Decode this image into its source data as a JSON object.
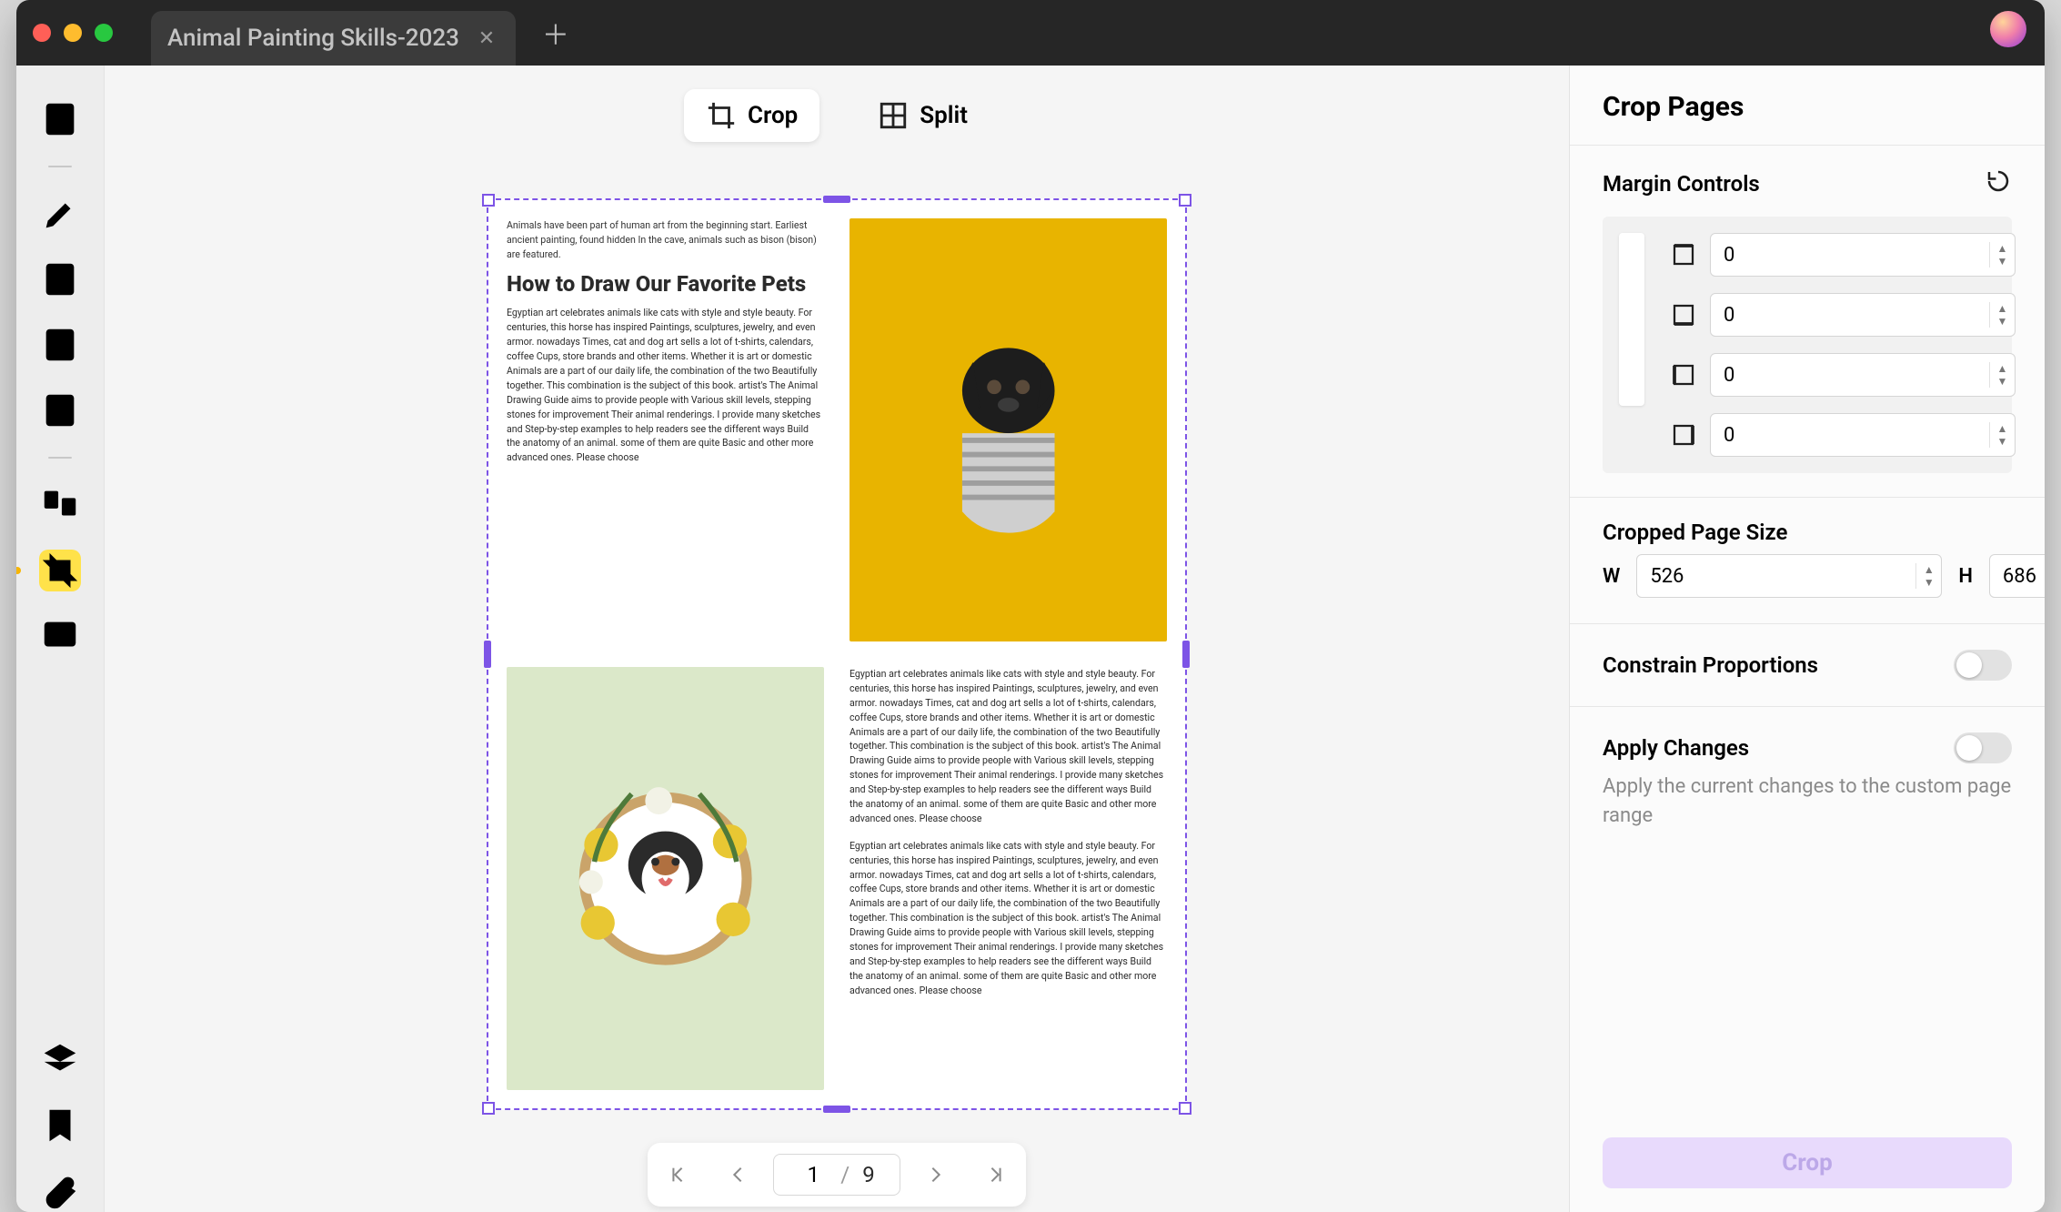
{
  "tab": {
    "title": "Animal Painting Skills-2023"
  },
  "toolbar": {
    "crop": "Crop",
    "split": "Split"
  },
  "document": {
    "intro": "Animals have been part of human art from the beginning start. Earliest ancient painting, found hidden In the cave, animals such as bison (bison) are featured.",
    "heading": "How to Draw Our Favorite Pets",
    "paragraph": "Egyptian art celebrates animals like cats with style and style beauty. For centuries, this horse has inspired Paintings, sculptures, jewelry, and even armor. nowadays Times, cat and dog art sells a lot of t-shirts, calendars, coffee Cups, store brands and other items. Whether it is art or domestic Animals are a part of our daily life, the combination of the two Beautifully together. This combination is the subject of this book. artist's The Animal Drawing Guide aims to provide people with Various skill levels, stepping stones for improvement Their animal renderings. I provide many sketches and Step-by-step examples to help readers see the different ways Build the anatomy of an animal. some of them are quite Basic and other more advanced ones. Please choose"
  },
  "pager": {
    "current": "1",
    "total": "9"
  },
  "side": {
    "title": "Crop Pages",
    "margin": {
      "label": "Margin Controls",
      "top": "0",
      "bottom": "0",
      "left": "0",
      "right": "0"
    },
    "size": {
      "label": "Cropped Page Size",
      "w_label": "W",
      "h_label": "H",
      "w": "526",
      "h": "686"
    },
    "constrain": {
      "label": "Constrain Proportions"
    },
    "apply": {
      "label": "Apply Changes",
      "helper": "Apply the current changes to the custom page range"
    },
    "crop_button": "Crop"
  }
}
